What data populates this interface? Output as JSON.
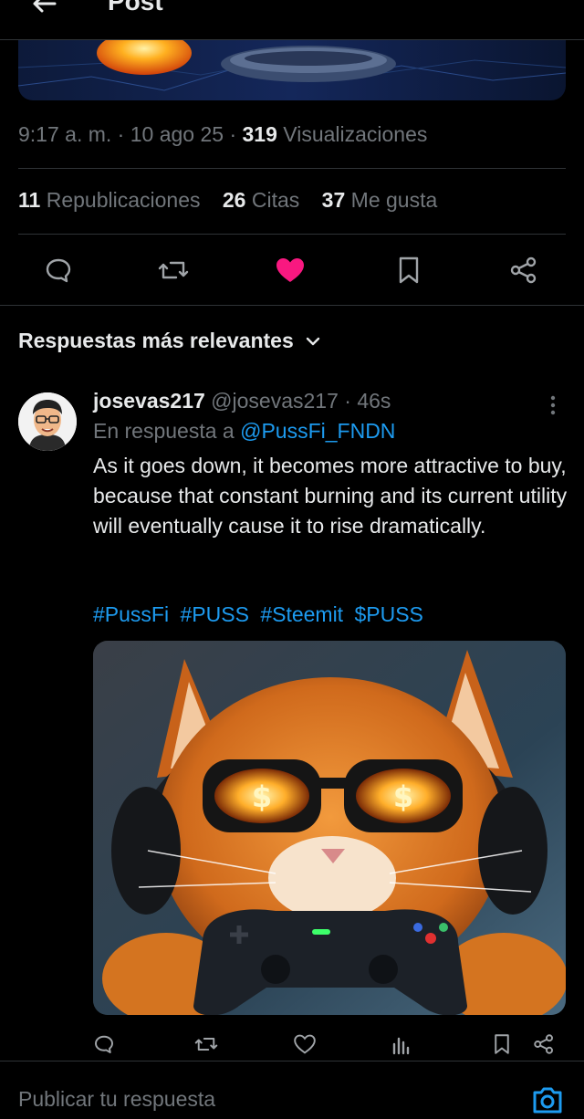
{
  "header": {
    "title": "Post"
  },
  "post": {
    "time": "9:17 a. m.",
    "dot": "·",
    "date": "10 ago 25",
    "views_count": "319",
    "views_label": "Visualizaciones",
    "reposts_count": "11",
    "reposts_label": "Republicaciones",
    "quotes_count": "26",
    "quotes_label": "Citas",
    "likes_count": "37",
    "likes_label": "Me gusta",
    "liked": true
  },
  "sort": {
    "label": "Respuestas más relevantes"
  },
  "reply": {
    "name": "josevas217",
    "handle": "@josevas217",
    "dot": "·",
    "time": "46s",
    "in_reply_prefix": "En respuesta a",
    "in_reply_handle": "@PussFi_FNDN",
    "text": "As it goes down, it becomes more attractive to buy, because that constant burning and its current utility will eventually cause it to rise dramatically.",
    "hashtags": [
      "#PussFi",
      "#PUSS",
      "#Steemit",
      "$PUSS"
    ]
  },
  "composer": {
    "placeholder": "Publicar tu respuesta"
  },
  "colors": {
    "accent": "#1d9bf0",
    "like": "#f91880",
    "muted": "#71767b",
    "border": "#2f3336"
  },
  "icons": {
    "back": "arrow-left-icon",
    "reply": "comment-icon",
    "repost": "repost-icon",
    "like": "heart-icon",
    "bookmark": "bookmark-icon",
    "share": "share-icon",
    "more": "more-vertical-icon",
    "views": "views-icon",
    "camera": "camera-icon",
    "chevron": "chevron-down-icon"
  }
}
